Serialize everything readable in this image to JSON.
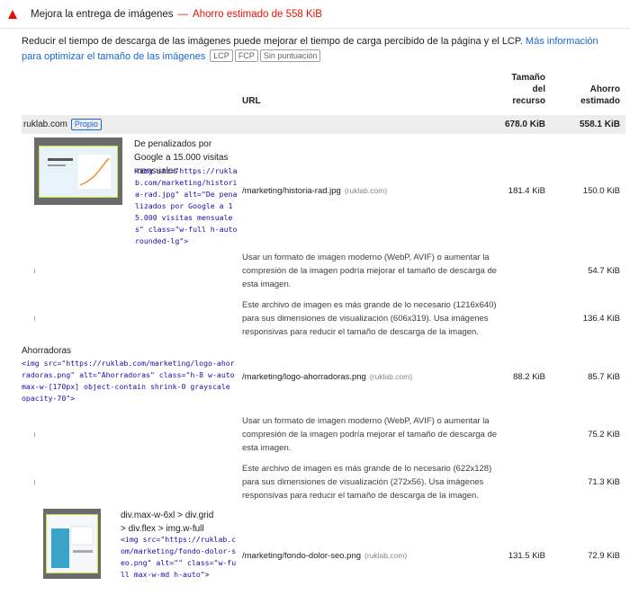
{
  "audit": {
    "title": "Mejora la entrega de imágenes",
    "separator": "—",
    "savings": "Ahorro estimado de 558 KiB",
    "warning_color": "#eb0f00"
  },
  "description": {
    "text": "Reducir el tiempo de descarga de las imágenes puede mejorar el tiempo de carga percibido de la página y el LCP. ",
    "link": "Más información para optimizar el tamaño de las imágenes",
    "badges": [
      "LCP",
      "FCP",
      "Sin puntuación"
    ]
  },
  "table": {
    "headers": {
      "url": "URL",
      "size": "Tamaño del recurso",
      "savings": "Ahorro estimado"
    },
    "entity": {
      "name": "ruklab.com",
      "badge": "Propio",
      "size": "678.0 KiB",
      "savings": "558.1 KiB"
    },
    "rows": [
      {
        "label": "De penalizados por Google a 15.000 visitas mensuales",
        "snippet": "<img src=\"https://ruklab.com/marketing/historia-rad.jpg\" alt=\"De penalizados por Google a 15.000 visitas mensuales\" class=\"w-full h-auto rounded-lg\">",
        "url": "/marketing/historia-rad.jpg",
        "host": "(ruklab.com)",
        "size": "181.4 KiB",
        "savings": "150.0 KiB",
        "subitems": [
          {
            "text": "Usar un formato de imagen moderno (WebP, AVIF) o aumentar la compresión de la imagen podría mejorar el tamaño de descarga de esta imagen.",
            "savings": "54.7 KiB"
          },
          {
            "text": "Este archivo de imagen es más grande de lo necesario (1216x640) para sus dimensiones de visualización (606x319). Usa imágenes responsivas para reducir el tamaño de descarga de la imagen.",
            "savings": "136.4 KiB"
          }
        ]
      },
      {
        "label": "Ahorradoras",
        "snippet": "<img src=\"https://ruklab.com/marketing/logo-ahorradoras.png\" alt=\"Ahorradoras\" class=\"h-8 w-auto max-w-[170px] object-contain shrink-0 grayscale opacity-70\">",
        "url": "/marketing/logo-ahorradoras.png",
        "host": "(ruklab.com)",
        "size": "88.2 KiB",
        "savings": "85.7 KiB",
        "subitems": [
          {
            "text": "Usar un formato de imagen moderno (WebP, AVIF) o aumentar la compresión de la imagen podría mejorar el tamaño de descarga de esta imagen.",
            "savings": "75.2 KiB"
          },
          {
            "text": "Este archivo de imagen es más grande de lo necesario (622x128) para sus dimensiones de visualización (272x56). Usa imágenes responsivas para reducir el tamaño de descarga de la imagen.",
            "savings": "71.3 KiB"
          }
        ]
      },
      {
        "label": "div.max-w-6xl > div.grid > div.flex > img.w-full",
        "snippet": "<img src=\"https://ruklab.com/marketing/fondo-dolor-seo.png\" alt=\"\" class=\"w-full max-w-md h-auto\">",
        "url": "/marketing/fondo-dolor-seo.png",
        "host": "(ruklab.com)",
        "size": "131.5 KiB",
        "savings": "72.9 KiB"
      }
    ]
  }
}
